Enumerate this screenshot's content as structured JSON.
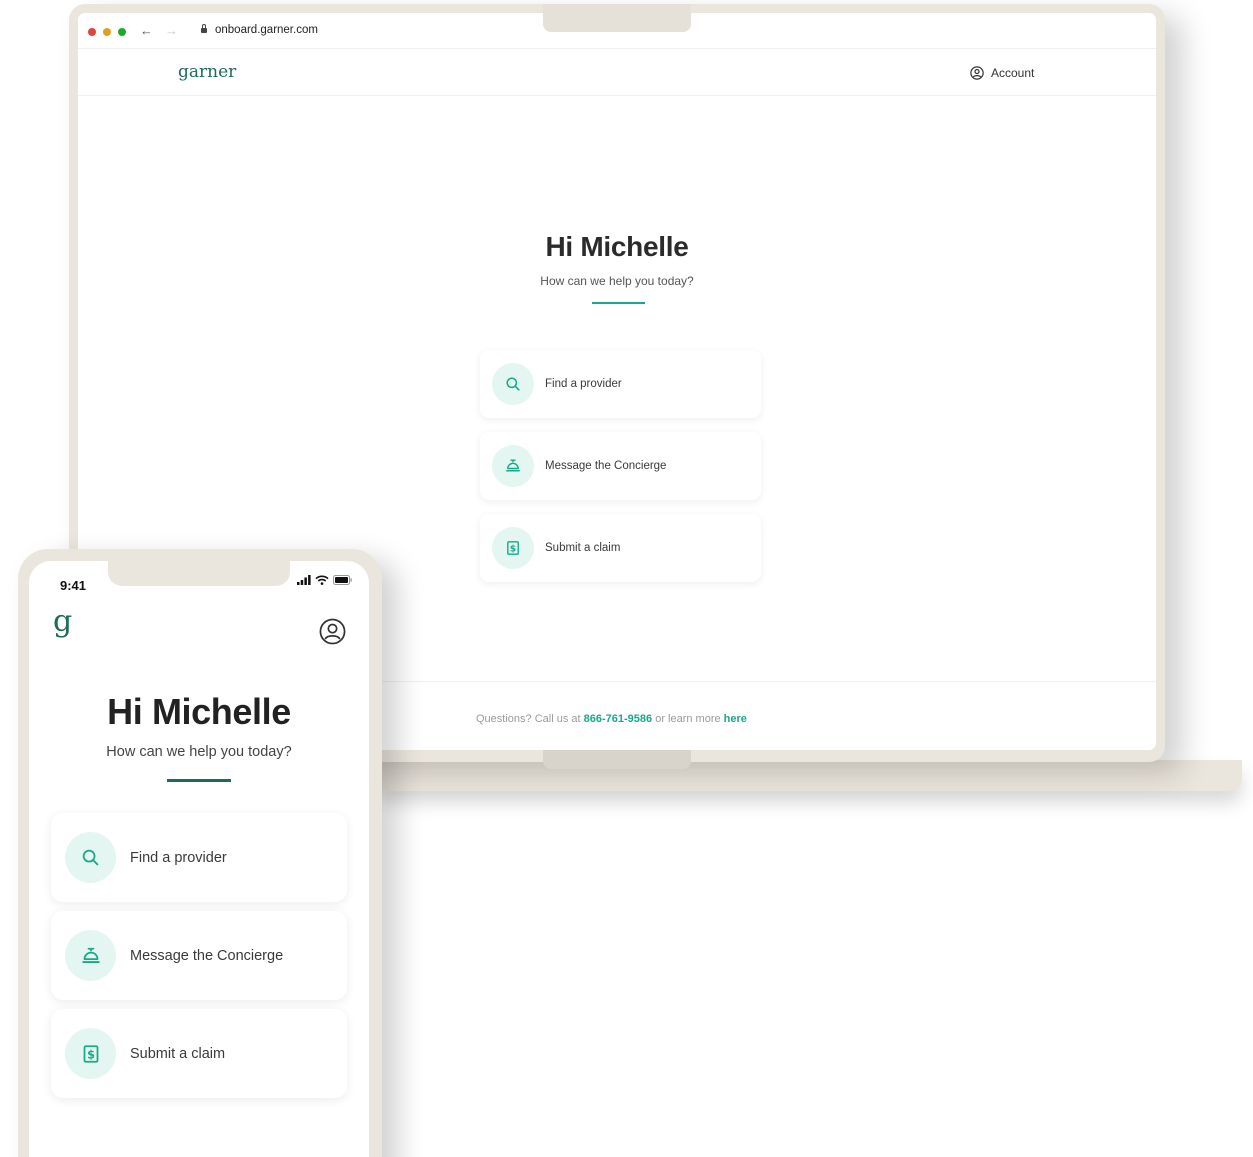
{
  "browser": {
    "url": "onboard.garner.com",
    "back_glyph": "←",
    "forward_glyph": "→"
  },
  "desktop": {
    "logo": "garner",
    "account_label": "Account",
    "greeting": "Hi Michelle",
    "subtitle": "How can we help you today?",
    "actions": [
      {
        "label": "Find a provider",
        "icon": "search-icon"
      },
      {
        "label": "Message the Concierge",
        "icon": "concierge-bell-icon"
      },
      {
        "label": "Submit a claim",
        "icon": "dollar-receipt-icon"
      }
    ],
    "footer": {
      "prefix": "Questions? Call us at ",
      "phone": "866-761-9586",
      "middle": " or learn more ",
      "link": "here"
    }
  },
  "mobile": {
    "time": "9:41",
    "logo": "g",
    "greeting": "Hi Michelle",
    "subtitle": "How can we help you today?",
    "actions": [
      {
        "label": "Find a provider",
        "icon": "search-icon"
      },
      {
        "label": "Message the Concierge",
        "icon": "concierge-bell-icon"
      },
      {
        "label": "Submit a claim",
        "icon": "dollar-receipt-icon"
      }
    ]
  },
  "colors": {
    "brand_green": "#1e6b58",
    "accent_teal": "#17a98a",
    "icon_bg": "#e3f6f1",
    "device_frame": "#ebe6dd"
  }
}
